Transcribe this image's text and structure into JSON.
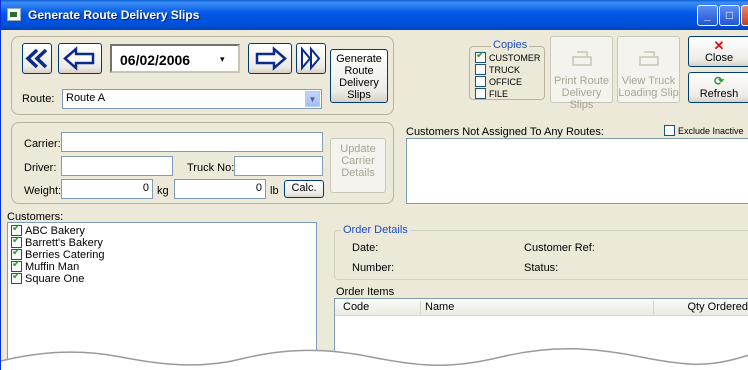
{
  "window": {
    "title": "Generate Route Delivery Slips"
  },
  "nav": {
    "date": "06/02/2006",
    "generate_label": "Generate Route Delivery Slips"
  },
  "route": {
    "label": "Route:",
    "value": "Route A"
  },
  "copies": {
    "title": "Copies",
    "items": [
      {
        "label": "CUSTOMER",
        "checked": true
      },
      {
        "label": "TRUCK",
        "checked": false
      },
      {
        "label": "OFFICE",
        "checked": false
      },
      {
        "label": "FILE",
        "checked": false
      }
    ]
  },
  "actions": {
    "print_route": "Print Route Delivery Slips",
    "view_truck": "View Truck Loading Slip",
    "close": "Close",
    "refresh": "Refresh"
  },
  "carrier": {
    "carrier_label": "Carrier:",
    "driver_label": "Driver:",
    "truck_label": "Truck No:",
    "weight_label": "Weight:",
    "weight_kg": "0",
    "kg_unit": "kg",
    "weight_lb": "0",
    "lb_unit": "lb",
    "calc_label": "Calc.",
    "update_label": "Update Carrier Details"
  },
  "unassigned": {
    "label": "Customers Not Assigned To Any Routes:",
    "exclude_label": "Exclude Inactive"
  },
  "customers": {
    "label": "Customers:",
    "items": [
      "ABC Bakery",
      "Barrett's Bakery",
      "Berries Catering",
      "Muffin Man",
      "Square One"
    ]
  },
  "order_details": {
    "title": "Order Details",
    "date_label": "Date:",
    "number_label": "Number:",
    "customer_ref_label": "Customer Ref:",
    "status_label": "Status:"
  },
  "order_items": {
    "label": "Order Items",
    "columns": [
      "Code",
      "Name",
      "Qty Ordered"
    ]
  }
}
